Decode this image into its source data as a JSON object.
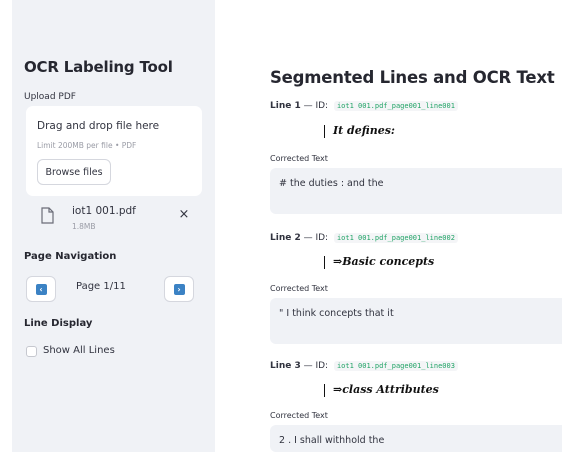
{
  "sidebar": {
    "app_title": "OCR Labeling Tool",
    "upload_label": "Upload PDF",
    "dropzone": {
      "title": "Drag and drop file here",
      "limit": "Limit 200MB per file • PDF",
      "browse_label": "Browse files"
    },
    "file": {
      "name": "iot1 001.pdf",
      "size": "1.8MB",
      "close_icon": "×"
    },
    "page_navigation": {
      "label": "Page Navigation",
      "prev_icon": "chevron-left-icon",
      "next_icon": "chevron-right-icon",
      "page_text": "Page 1/11"
    },
    "line_display": {
      "label": "Line Display",
      "show_all_label": "Show All Lines",
      "show_all_checked": false
    }
  },
  "main": {
    "title": "Segmented Lines and OCR Text",
    "lines": [
      {
        "label": "Line 1",
        "id_prefix": " — ID: ",
        "id": "iot1 001.pdf_page001_line001",
        "handwriting": "It  defines:",
        "corrected_label": "Corrected Text",
        "corrected_text": "# the duties : and the"
      },
      {
        "label": "Line 2",
        "id_prefix": " — ID: ",
        "id": "iot1 001.pdf_page001_line002",
        "handwriting": "⇒Basic  concepts",
        "corrected_label": "Corrected Text",
        "corrected_text": "\" I think concepts that it"
      },
      {
        "label": "Line 3",
        "id_prefix": " — ID: ",
        "id": "iot1 001.pdf_page001_line003",
        "handwriting": "⇒class  Attributes",
        "corrected_label": "Corrected Text",
        "corrected_text": "2 . I shall withhold the"
      }
    ]
  },
  "colors": {
    "sidebar_bg": "#f0f2f6",
    "id_code_text": "#21a366",
    "nav_arrow": "#3b82c4"
  }
}
